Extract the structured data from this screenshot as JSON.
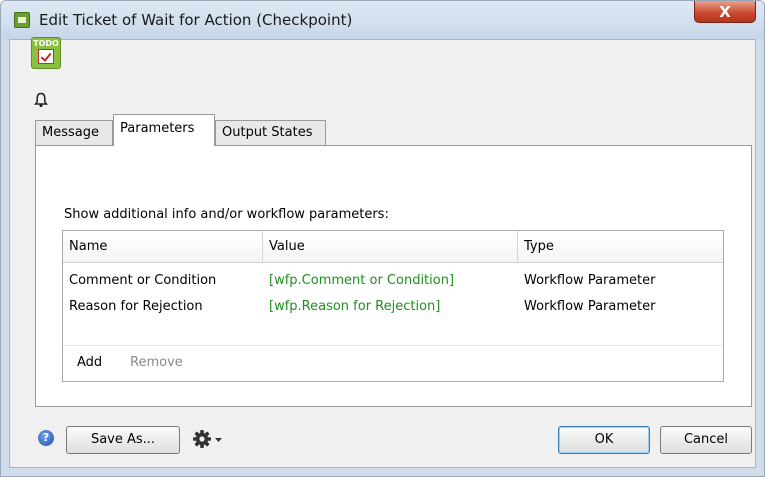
{
  "window": {
    "title": "Edit Ticket of Wait for Action (Checkpoint)",
    "close_glyph": "X"
  },
  "icons": {
    "todo_label": "TODO"
  },
  "tabs": [
    {
      "label": "Message",
      "active": false
    },
    {
      "label": "Parameters",
      "active": true
    },
    {
      "label": "Output States",
      "active": false
    }
  ],
  "panel": {
    "caption": "Show additional info and/or workflow parameters:",
    "columns": [
      "Name",
      "Value",
      "Type"
    ],
    "rows": [
      {
        "name": "Comment or Condition",
        "value": "[wfp.Comment or Condition]",
        "type": "Workflow Parameter"
      },
      {
        "name": "Reason for Rejection",
        "value": "[wfp.Reason for Rejection]",
        "type": "Workflow Parameter"
      }
    ],
    "add_label": "Add",
    "remove_label": "Remove"
  },
  "footer": {
    "help_glyph": "?",
    "save_as_label": "Save As...",
    "ok_label": "OK",
    "cancel_label": "Cancel"
  },
  "colors": {
    "value_text": "#1f8f1f",
    "disabled_text": "#8a8a8a",
    "close_button": "#c9462b"
  }
}
